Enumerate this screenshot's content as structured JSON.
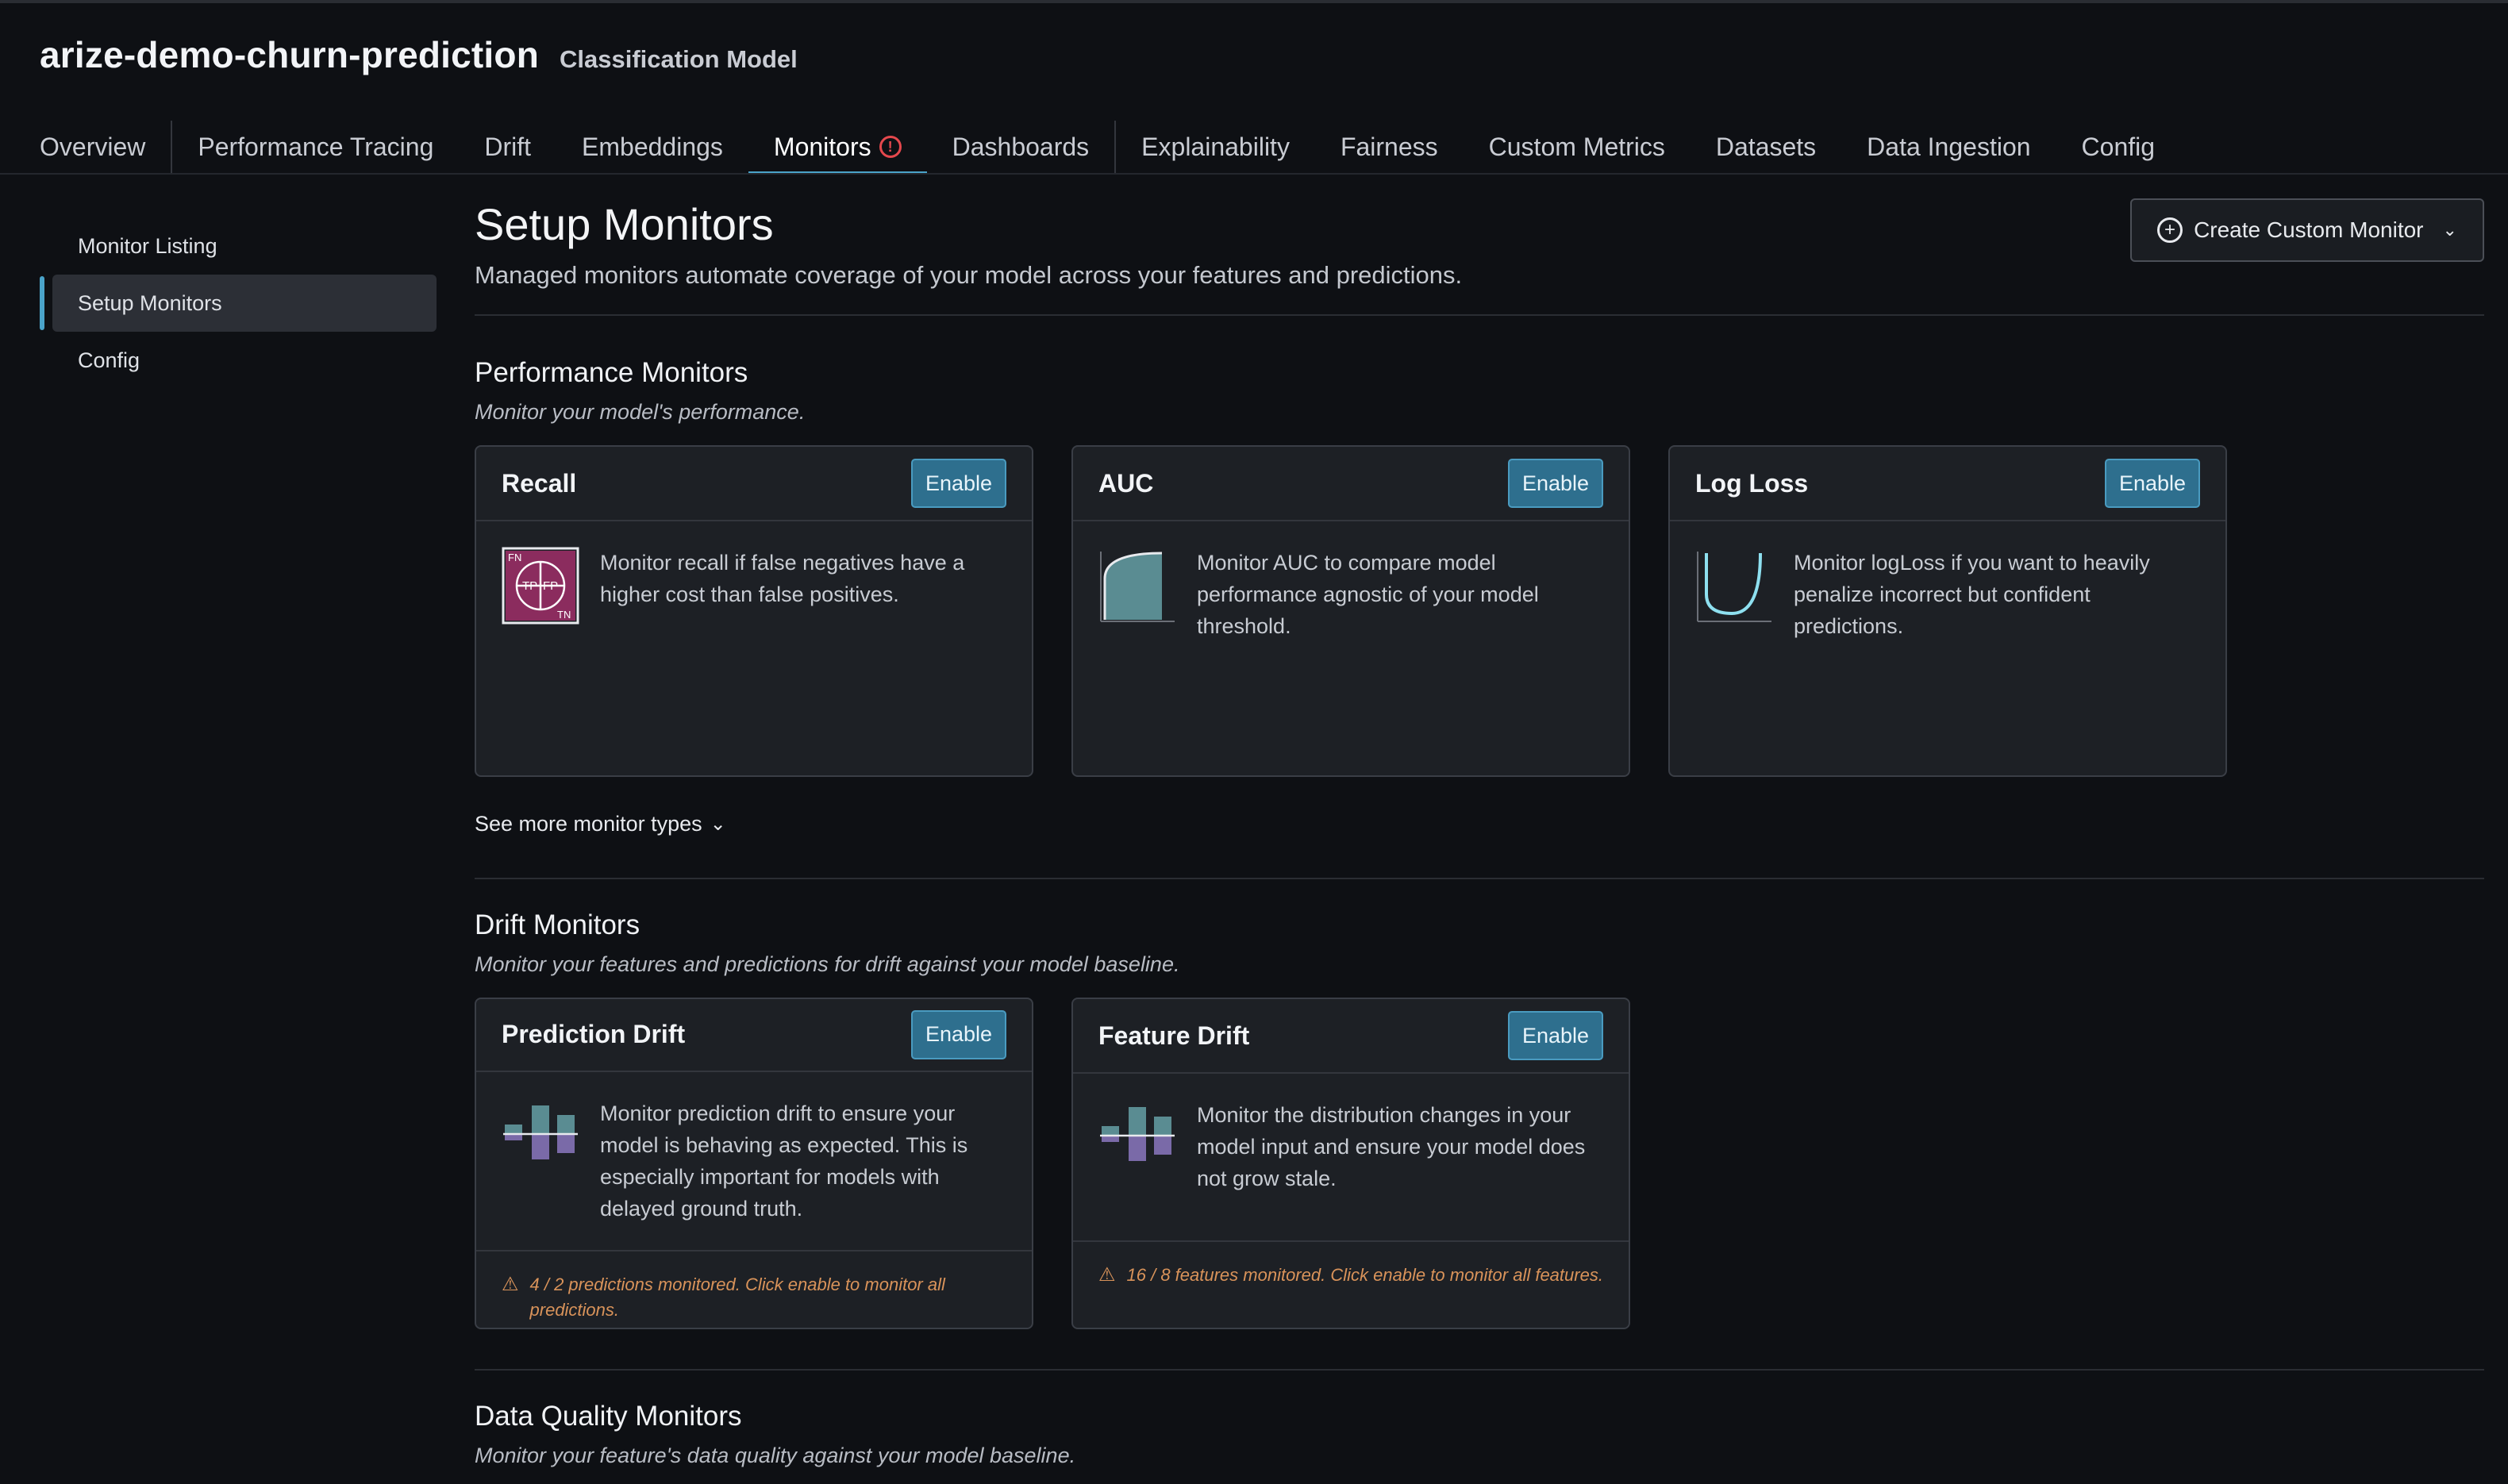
{
  "header": {
    "model_name": "arize-demo-churn-prediction",
    "model_type": "Classification Model"
  },
  "tabs": [
    {
      "label": "Overview"
    },
    {
      "label": "Performance Tracing"
    },
    {
      "label": "Drift"
    },
    {
      "label": "Embeddings"
    },
    {
      "label": "Monitors",
      "active": true,
      "alert": "!"
    },
    {
      "label": "Dashboards"
    },
    {
      "label": "Explainability"
    },
    {
      "label": "Fairness"
    },
    {
      "label": "Custom Metrics"
    },
    {
      "label": "Datasets"
    },
    {
      "label": "Data Ingestion"
    },
    {
      "label": "Config"
    }
  ],
  "sidebar": {
    "items": [
      {
        "label": "Monitor Listing"
      },
      {
        "label": "Setup Monitors",
        "active": true
      },
      {
        "label": "Config"
      }
    ]
  },
  "main": {
    "title": "Setup Monitors",
    "subtitle": "Managed monitors automate coverage of your model across your features and predictions.",
    "create_button": "Create Custom Monitor"
  },
  "performance": {
    "title": "Performance Monitors",
    "subtitle": "Monitor your model's performance.",
    "see_more": "See more monitor types",
    "cards": [
      {
        "title": "Recall",
        "button": "Enable",
        "icon": "confusion-matrix-icon",
        "text": "Monitor recall if false negatives have a higher cost than false positives.",
        "icon_labels": {
          "fn": "FN",
          "tp": "TP",
          "fp": "FP",
          "tn": "TN"
        }
      },
      {
        "title": "AUC",
        "button": "Enable",
        "icon": "auc-curve-icon",
        "text": "Monitor AUC to compare model performance agnostic of your model threshold."
      },
      {
        "title": "Log Loss",
        "button": "Enable",
        "icon": "log-loss-curve-icon",
        "text": "Monitor logLoss if you want to heavily penalize incorrect but confident predictions."
      }
    ]
  },
  "drift": {
    "title": "Drift Monitors",
    "subtitle": "Monitor your features and predictions for drift against your model baseline.",
    "cards": [
      {
        "title": "Prediction Drift",
        "button": "Enable",
        "icon": "distribution-bars-icon",
        "text": "Monitor prediction drift to ensure your model is behaving as expected. This is especially important for models with delayed ground truth.",
        "warning": "4 / 2 predictions monitored. Click enable to monitor all predictions."
      },
      {
        "title": "Feature Drift",
        "button": "Enable",
        "icon": "distribution-bars-icon",
        "text": "Monitor the distribution changes in your model input and ensure your model does not grow stale.",
        "warning": "16 / 8 features monitored. Click enable to monitor all features."
      }
    ]
  },
  "data_quality": {
    "title": "Data Quality Monitors",
    "subtitle": "Monitor your feature's data quality against your model baseline."
  },
  "colors": {
    "accent": "#4aa3c9",
    "enable_bg": "#2e6f8e",
    "warning": "#d9935a",
    "alert": "#e5484d",
    "background": "#0e1014",
    "card": "#1d2025"
  }
}
